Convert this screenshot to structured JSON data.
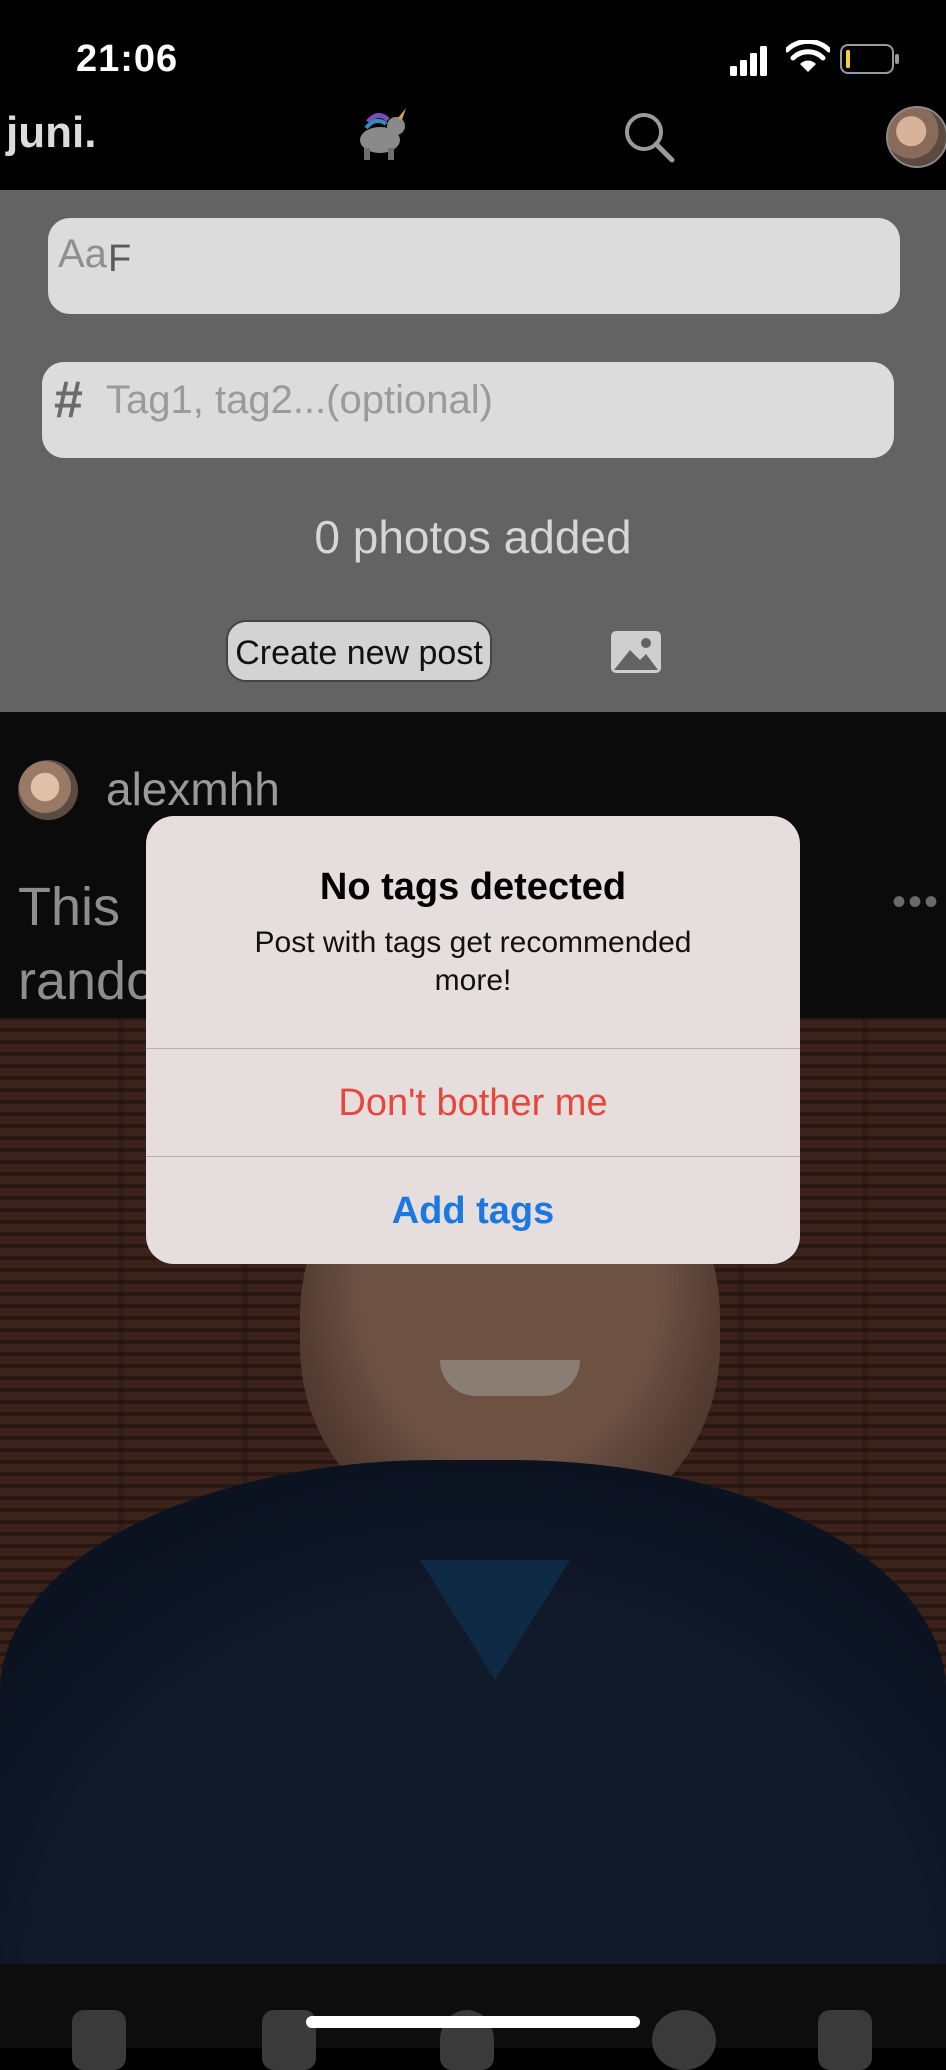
{
  "status_bar": {
    "time": "21:06"
  },
  "nav": {
    "brand": "juni."
  },
  "composer": {
    "title_placeholder": "Aa",
    "title_value": "F",
    "tags_hash": "#",
    "tags_placeholder": "Tag1, tag2...(optional)",
    "photos_added": "0 photos added",
    "create_post_label": "Create new post"
  },
  "post": {
    "username": "alexmhh",
    "text_line1": "This",
    "text_line2": "rando",
    "more": "•••"
  },
  "alert": {
    "title": "No tags detected",
    "message": "Post with tags get recommended more!",
    "dont_bother_label": "Don't bother me",
    "add_tags_label": "Add tags"
  },
  "colors": {
    "destructive": "#e6463c",
    "action": "#1b78e0",
    "composer_bg": "#636363"
  },
  "icons": [
    "signal-icon",
    "wifi-icon",
    "battery-icon",
    "unicorn-logo-icon",
    "search-icon",
    "image-icon",
    "more-icon"
  ]
}
